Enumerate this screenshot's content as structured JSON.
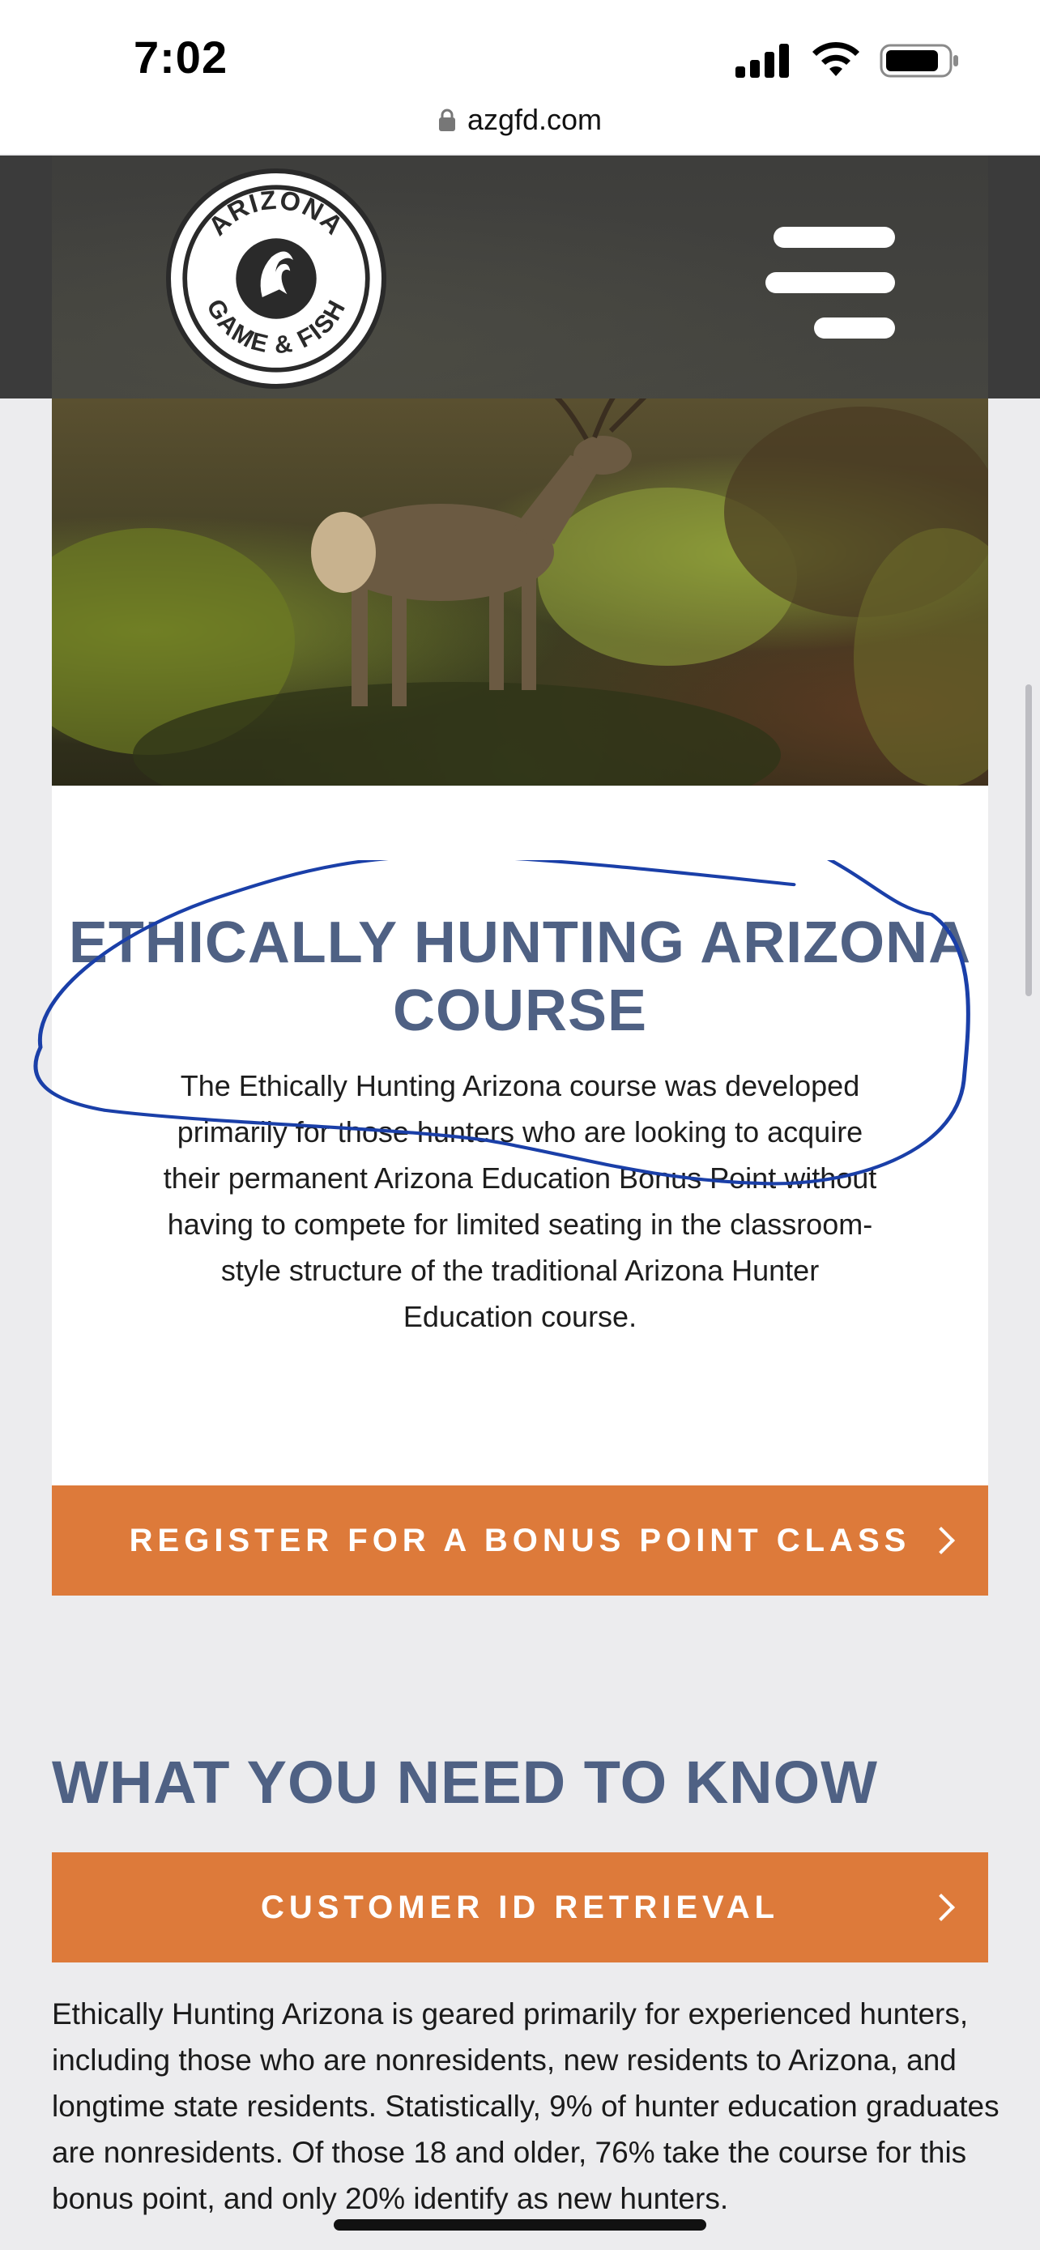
{
  "status_bar": {
    "time": "7:02",
    "icons": [
      "signal-icon",
      "wifi-icon",
      "battery-icon"
    ]
  },
  "browser": {
    "url": "azgfd.com",
    "icon": "lock-icon"
  },
  "header": {
    "logo_text": "ARIZONA GAME & FISH",
    "menu_icon": "hamburger-menu-icon",
    "background_color": "#3b3b3b"
  },
  "card": {
    "title": "ETHICALLY HUNTING ARIZONA COURSE",
    "description": "The Ethically Hunting Arizona course was developed primarily for those hunters who are looking to acquire their permanent Arizona Education Bonus Point without having to compete for limited seating in the classroom-style structure of the traditional Arizona Hunter Education course.",
    "register_label": "REGISTER FOR A BONUS POINT CLASS"
  },
  "need_to_know": {
    "heading": "WHAT YOU NEED TO KNOW",
    "customer_id_label": "CUSTOMER ID RETRIEVAL",
    "paragraph": "Ethically Hunting Arizona is geared primarily for experienced hunters, including those who are nonresidents, new residents to Arizona, and longtime state residents. Statistically, 9% of hunter education graduates are nonresidents. Of those 18 and older, 76% take the course for this bonus point, and only 20% identify as new hunters."
  },
  "colors": {
    "accent_orange": "#dd7a3a",
    "heading_blue": "#4f6184",
    "annotation_blue": "#1a3fa8",
    "page_bg": "#ececee"
  }
}
